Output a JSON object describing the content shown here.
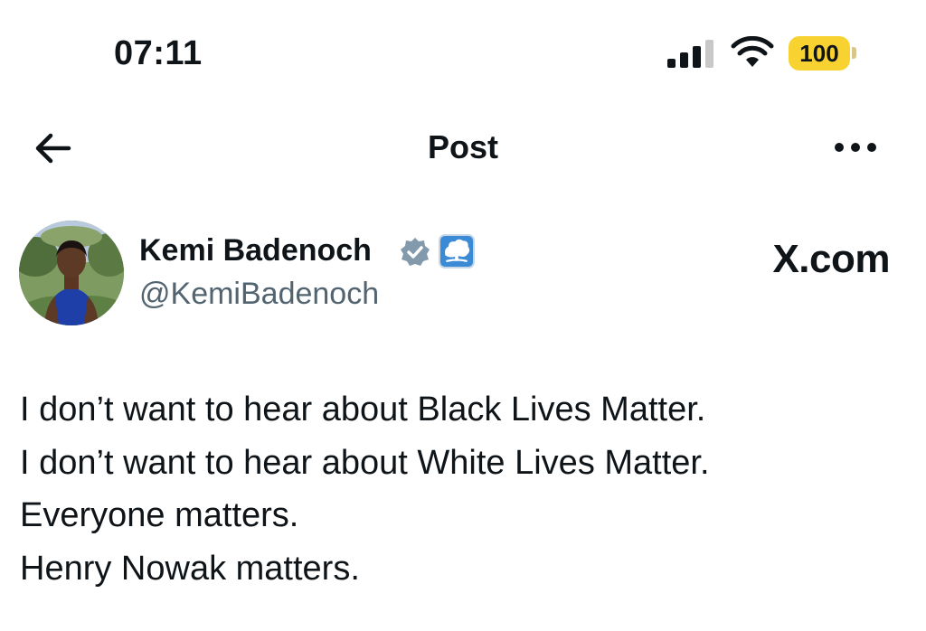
{
  "status_bar": {
    "time": "07:11",
    "battery": "100",
    "signal_icon": "cellular-signal-icon",
    "wifi_icon": "wifi-icon",
    "battery_color": "#f7d230"
  },
  "header": {
    "title": "Post",
    "back_icon": "arrow-left-icon",
    "more_icon": "ellipsis-icon"
  },
  "author": {
    "name": "Kemi Badenoch",
    "handle": "@KemiBadenoch",
    "verified_icon": "verified-badge-icon",
    "affiliate_icon": "conservative-tree-icon",
    "accent_color": "#3a8ad6"
  },
  "site_label": "X.com",
  "post": {
    "lines": [
      "I don’t want to hear about Black Lives Matter.",
      "I don’t want to hear about White Lives Matter.",
      "Everyone matters.",
      "Henry Nowak matters."
    ]
  }
}
